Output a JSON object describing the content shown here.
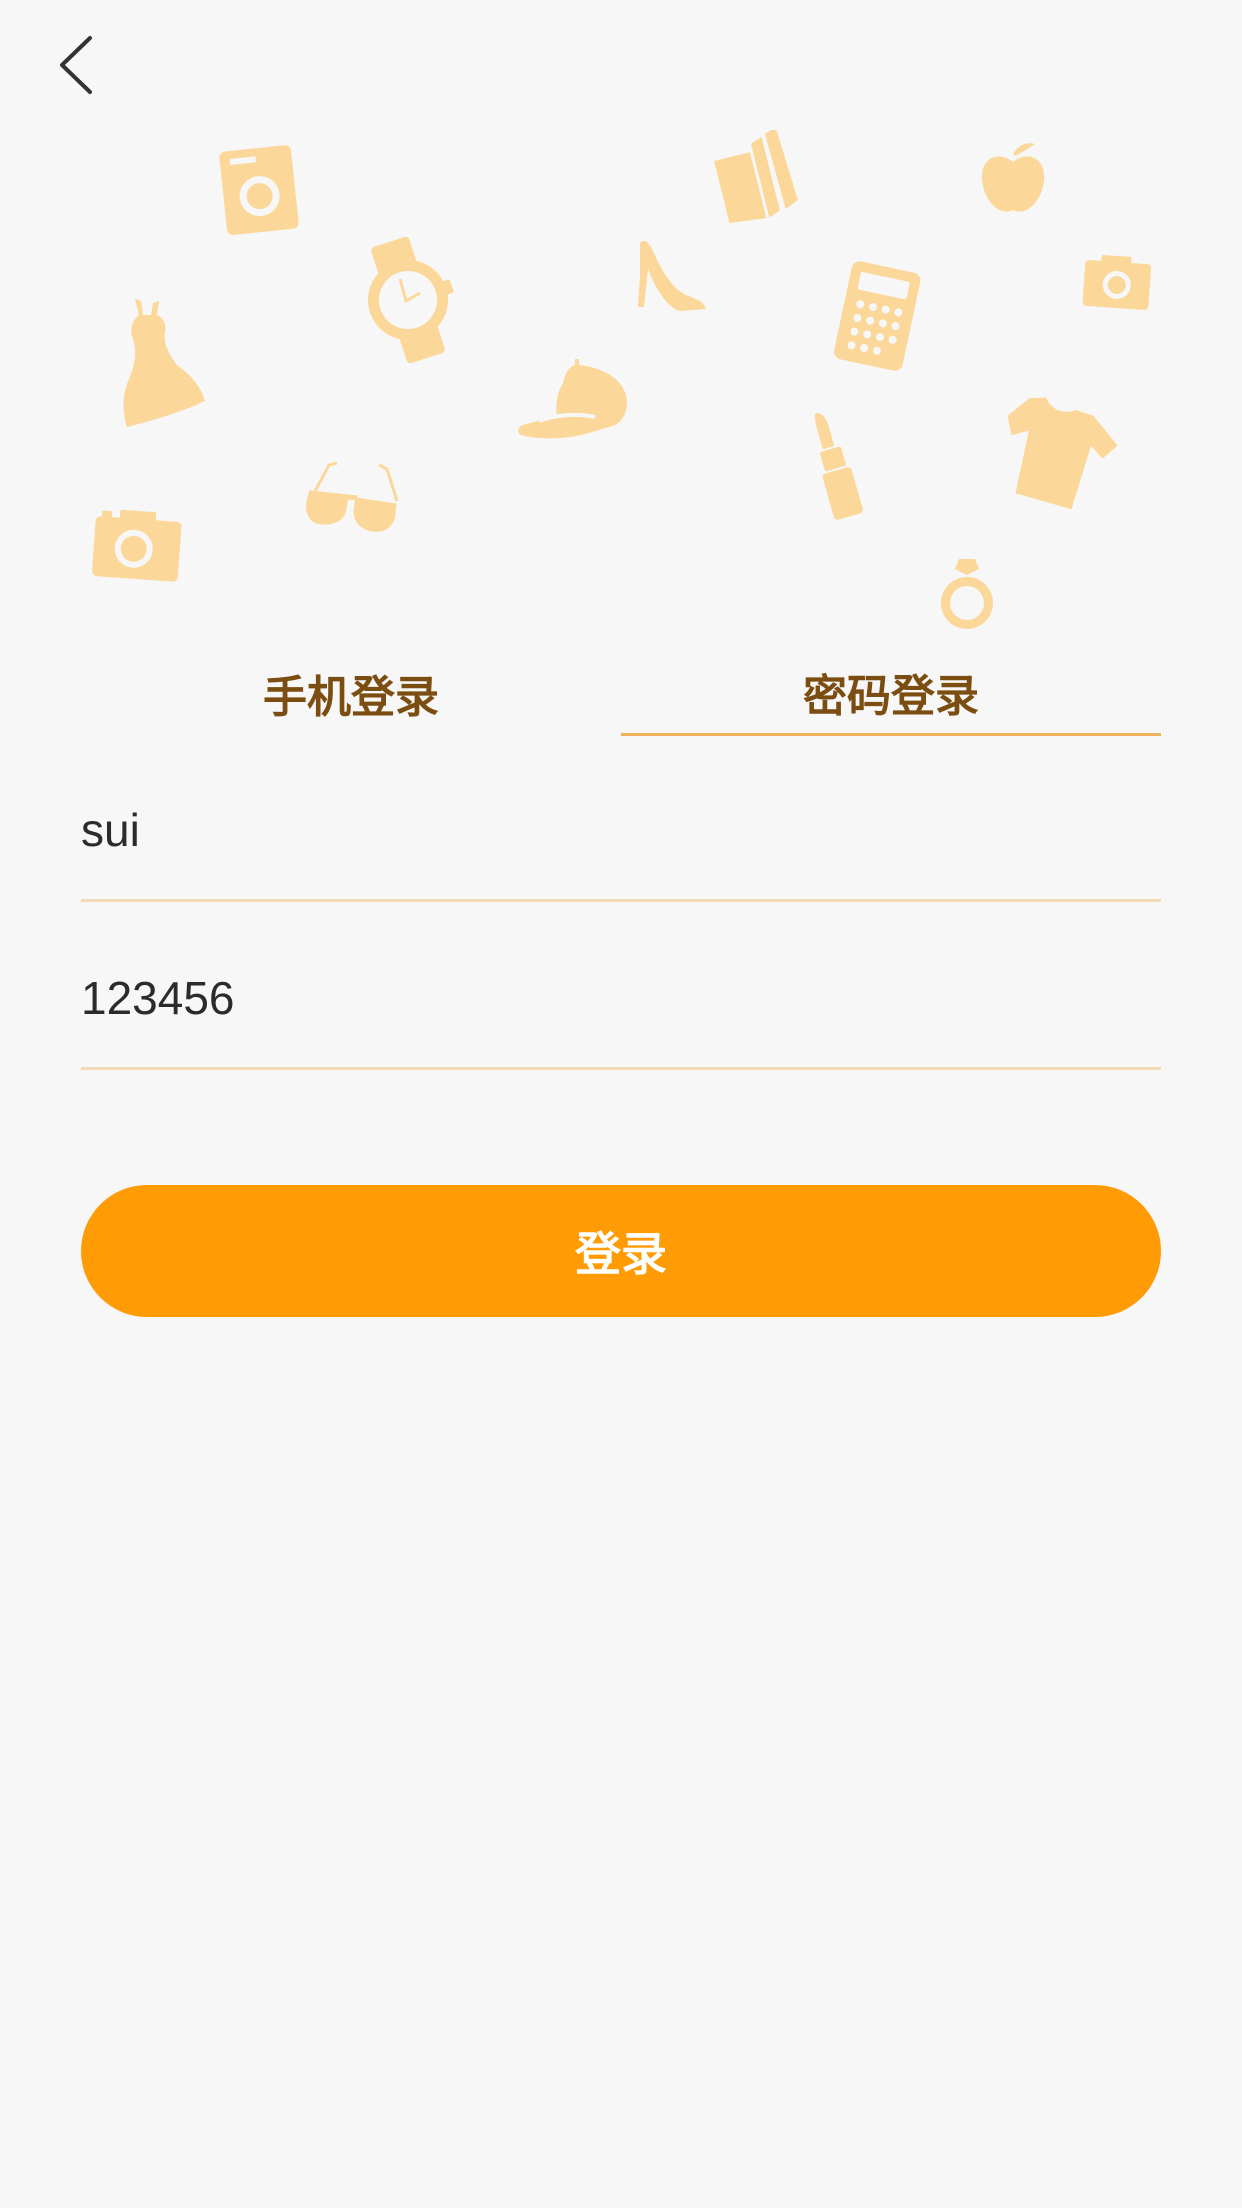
{
  "tabs": [
    {
      "label": "手机登录",
      "active": false
    },
    {
      "label": "密码登录",
      "active": true
    }
  ],
  "form": {
    "username_value": "sui",
    "password_value": "123456"
  },
  "login_button": {
    "label": "登录"
  },
  "colors": {
    "background": "#f7f7f7",
    "accent": "#ff9b05",
    "tab_text": "#7b4d10",
    "tab_underline": "#f0b25a",
    "field_underline": "#f3d9b4",
    "decor_icons": "#fbd89a"
  },
  "decorative_icons": [
    "camera-icon",
    "book-icon",
    "apple-icon",
    "camera-icon",
    "watch-icon",
    "high-heel-icon",
    "calculator-icon",
    "dress-icon",
    "cap-icon",
    "lipstick-icon",
    "tshirt-icon",
    "sunglasses-icon",
    "camera-icon",
    "ring-icon"
  ]
}
